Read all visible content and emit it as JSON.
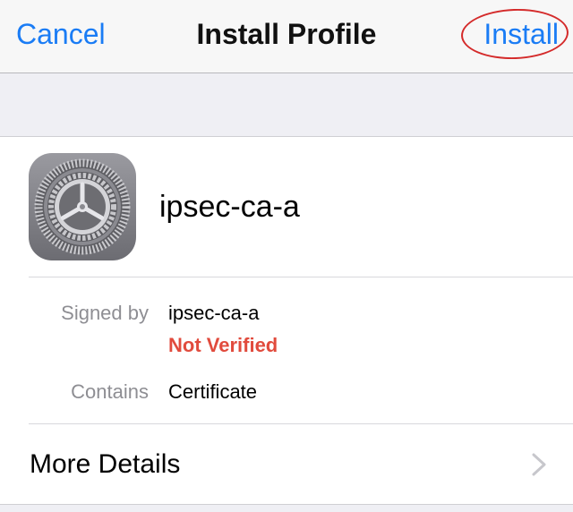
{
  "nav": {
    "cancel_label": "Cancel",
    "title": "Install Profile",
    "install_label": "Install"
  },
  "profile": {
    "name": "ipsec-ca-a",
    "icon": "settings-gear-icon",
    "signed_by_label": "Signed by",
    "signed_by_value": "ipsec-ca-a",
    "verification_status": "Not Verified",
    "contains_label": "Contains",
    "contains_value": "Certificate"
  },
  "more_details": {
    "label": "More Details",
    "icon": "chevron-right-icon"
  },
  "colors": {
    "accent": "#1a7cf5",
    "warning": "#e14b3d",
    "annotation": "#d42a2a",
    "secondary_text": "#8e8e93"
  }
}
